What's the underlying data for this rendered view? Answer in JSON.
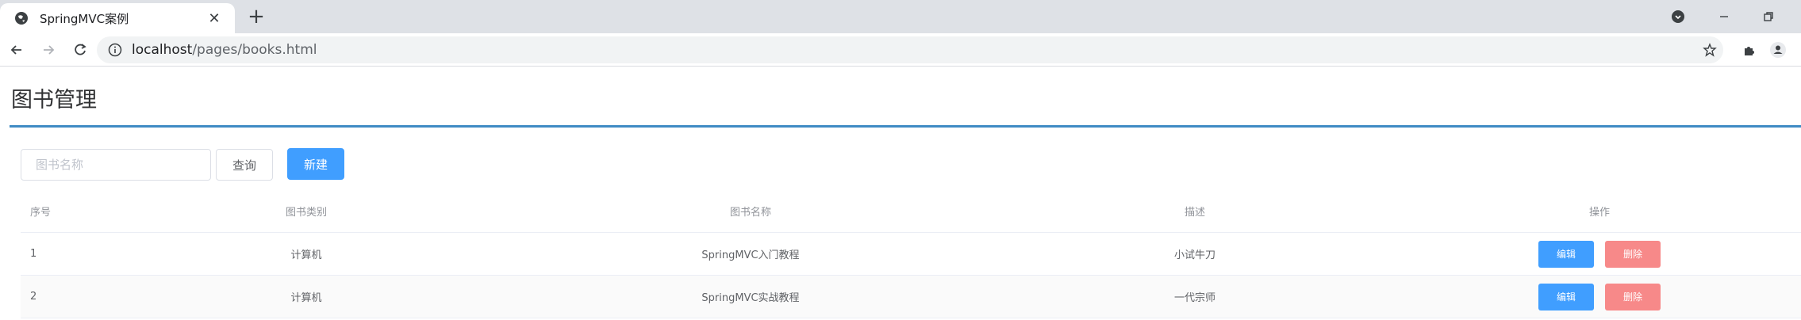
{
  "browser": {
    "tab_title": "SpringMVC案例",
    "url_host": "localhost",
    "url_path": "/pages/books.html"
  },
  "page": {
    "title": "图书管理",
    "search_placeholder": "图书名称",
    "search_value": "",
    "query_label": "查询",
    "new_label": "新建"
  },
  "table": {
    "headers": {
      "index": "序号",
      "type": "图书类别",
      "name": "图书名称",
      "desc": "描述",
      "ops": "操作"
    },
    "rows": [
      {
        "index": "1",
        "type": "计算机",
        "name": "SpringMVC入门教程",
        "desc": "小试牛刀",
        "edit": "编辑",
        "delete": "删除"
      },
      {
        "index": "2",
        "type": "计算机",
        "name": "SpringMVC实战教程",
        "desc": "一代宗师",
        "edit": "编辑",
        "delete": "删除"
      }
    ]
  },
  "colors": {
    "accent": "#409eff",
    "danger": "#f78989",
    "title_rule": "#3f8bc4"
  }
}
